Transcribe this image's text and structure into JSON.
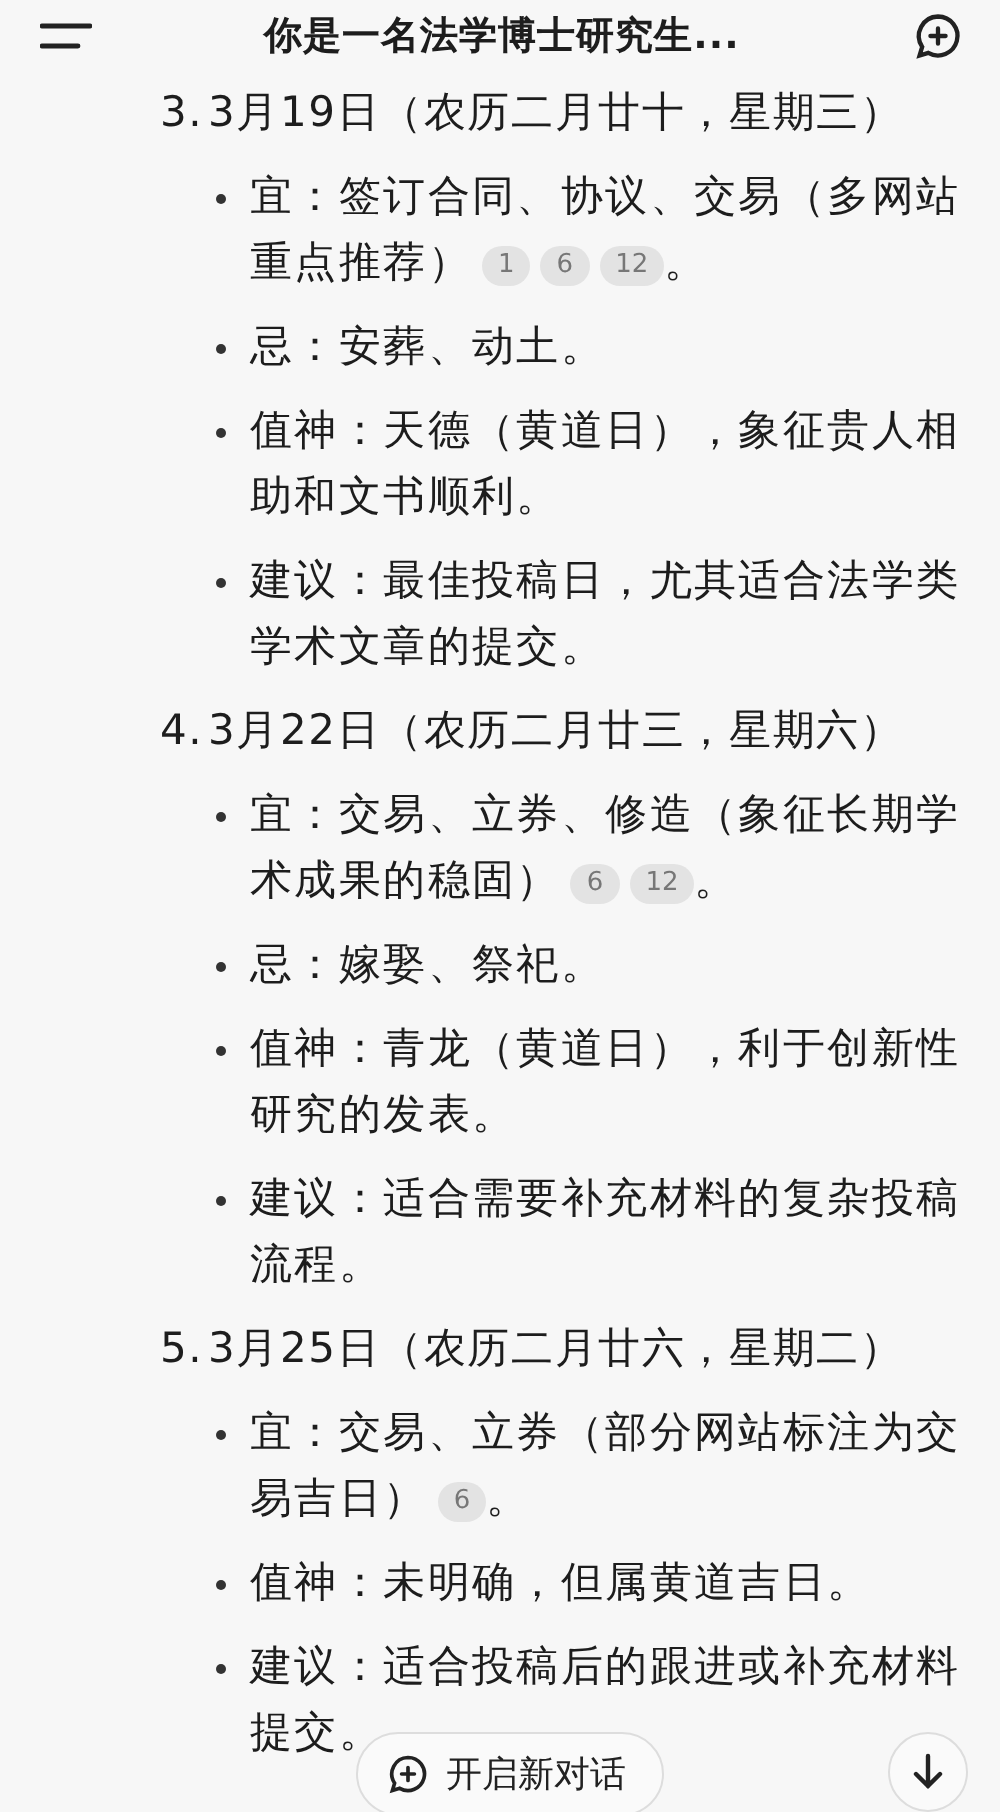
{
  "header": {
    "title": "你是一名法学博士研究生..."
  },
  "sections": [
    {
      "number": "3.",
      "heading": "3月19日（农历二月廿十，星期三）",
      "bullets": [
        {
          "text": "宜：签订合同、协议、交易（多网站重点推荐）",
          "citations": [
            "1",
            "6",
            "12"
          ],
          "end": "。"
        },
        {
          "text": "忌：安葬、动土。"
        },
        {
          "text": "值神：天德（黄道日），象征贵人相助和文书顺利。"
        },
        {
          "text": "建议：最佳投稿日，尤其适合法学类学术文章的提交。"
        }
      ]
    },
    {
      "number": "4.",
      "heading": "3月22日（农历二月廿三，星期六）",
      "bullets": [
        {
          "text": "宜：交易、立券、修造（象征长期学术成果的稳固）",
          "citations": [
            "6",
            "12"
          ],
          "end": "。"
        },
        {
          "text": "忌：嫁娶、祭祀。"
        },
        {
          "text": "值神：青龙（黄道日），利于创新性研究的发表。"
        },
        {
          "text": "建议：适合需要补充材料的复杂投稿流程。"
        }
      ]
    },
    {
      "number": "5.",
      "heading": "3月25日（农历二月廿六，星期二）",
      "bullets": [
        {
          "text": "宜：交易、立券（部分网站标注为交易吉日）",
          "citations": [
            "6"
          ],
          "end": "。"
        },
        {
          "text": "值神：未明确，但属黄道吉日。"
        },
        {
          "text": "建议：适合投稿后的跟进或补充材料提交。"
        }
      ]
    }
  ],
  "new_chat_button": {
    "label": "开启新对话"
  }
}
